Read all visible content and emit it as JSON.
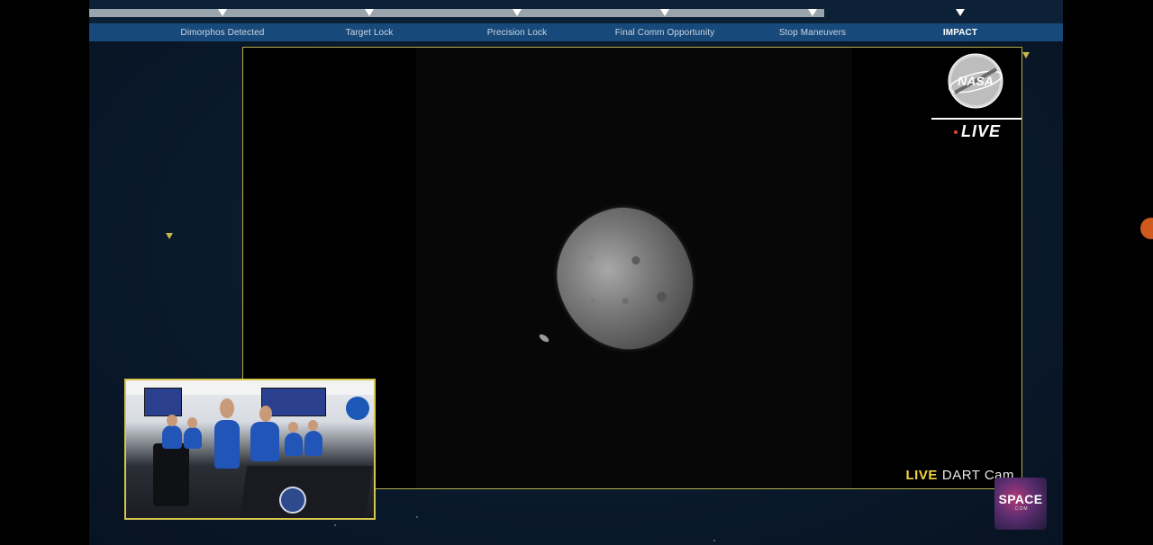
{
  "timeline": {
    "progress_pct": 75.5,
    "milestones": [
      {
        "label": "Dimorphos Detected"
      },
      {
        "label": "Target Lock"
      },
      {
        "label": "Precision Lock"
      },
      {
        "label": "Final Comm Opportunity"
      },
      {
        "label": "Stop Maneuvers"
      },
      {
        "label": "IMPACT"
      }
    ]
  },
  "main_video": {
    "logo_text": "NASA",
    "live_badge": "LIVE",
    "caption_live": "LIVE",
    "caption_cam": "DART Cam"
  },
  "inset": {
    "description_icon": "mission-control-room-feed"
  },
  "branding": {
    "space_logo_word": "SPACE",
    "space_logo_sub": ".COM"
  },
  "colors": {
    "accent_yellow": "#d5c64e",
    "timeline_blue": "#17497a",
    "live_red": "#e04a2a"
  }
}
